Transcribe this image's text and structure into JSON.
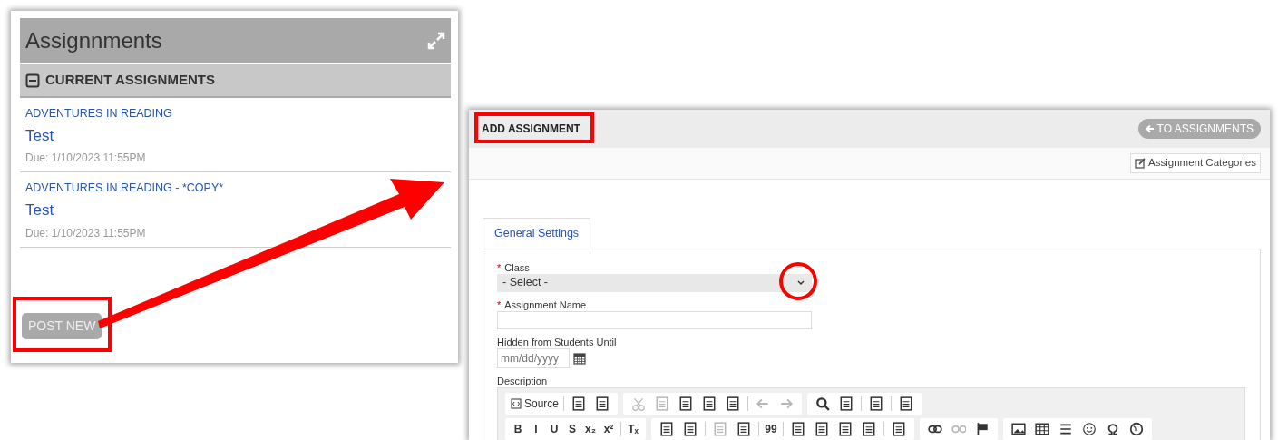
{
  "left_panel": {
    "title": "Assignnments",
    "section": {
      "title": "CURRENT ASSIGNMENTS",
      "expanded": true
    },
    "assignments": [
      {
        "class_name": "ADVENTURES IN READING",
        "title": "Test",
        "due": "Due: 1/10/2023 11:55PM"
      },
      {
        "class_name": "ADVENTURES IN READING - *COPY*",
        "title": "Test",
        "due": "Due: 1/10/2023 11:55PM"
      }
    ],
    "post_button": "POST NEW"
  },
  "right_panel": {
    "title": "ADD ASSIGNMENT",
    "back_button": "TO ASSIGNMENTS",
    "categories_button": "Assignment Categories",
    "tabs": [
      {
        "label": "General Settings",
        "selected": true
      }
    ],
    "fields": [
      {
        "kind": "select",
        "label": "Class",
        "required_mark": "*",
        "value": "- Select -"
      },
      {
        "kind": "text",
        "label": "Assignment Name",
        "required_mark": "*"
      },
      {
        "kind": "date",
        "label": "Hidden from Students Until",
        "placeholder": "mm/dd/yyyy"
      },
      {
        "kind": "editor",
        "label": "Description"
      }
    ],
    "toolbar_rows": [
      [
        [
          [
            {
              "kind": "icon-text",
              "label": "Source",
              "disabled": false
            }
          ],
          [
            {
              "kind": "icon",
              "disabled": false
            },
            {
              "kind": "icon",
              "disabled": false
            }
          ]
        ],
        [
          [
            {
              "kind": "icon",
              "disabled": true
            },
            {
              "kind": "icon",
              "disabled": true
            },
            {
              "kind": "icon",
              "disabled": false
            },
            {
              "kind": "icon",
              "disabled": false
            },
            {
              "kind": "icon",
              "disabled": false
            }
          ],
          [
            {
              "kind": "icon",
              "disabled": true
            },
            {
              "kind": "icon",
              "disabled": true
            }
          ]
        ],
        [
          [
            {
              "kind": "icon",
              "disabled": false
            },
            {
              "kind": "icon",
              "disabled": false
            }
          ],
          [
            {
              "kind": "icon",
              "disabled": false
            }
          ],
          [
            {
              "kind": "icon",
              "disabled": false
            }
          ]
        ]
      ],
      [
        [
          [
            {
              "kind": "glyph",
              "label": "B",
              "disabled": false
            },
            {
              "kind": "glyph",
              "label": "I",
              "disabled": false
            },
            {
              "kind": "glyph",
              "label": "U",
              "disabled": false
            },
            {
              "kind": "glyph",
              "label": "S",
              "disabled": false
            },
            {
              "kind": "glyph",
              "label": "x₂",
              "disabled": false
            },
            {
              "kind": "glyph",
              "label": "x²",
              "disabled": false
            }
          ],
          [
            {
              "kind": "glyph",
              "label": "Tₓ",
              "disabled": false
            }
          ]
        ],
        [
          [
            {
              "kind": "icon",
              "disabled": false
            },
            {
              "kind": "icon",
              "disabled": false
            }
          ],
          [
            {
              "kind": "icon",
              "disabled": true
            },
            {
              "kind": "icon",
              "disabled": false
            }
          ],
          [
            {
              "kind": "glyph",
              "label": "99",
              "disabled": false
            }
          ],
          [
            {
              "kind": "icon",
              "disabled": false
            },
            {
              "kind": "icon",
              "disabled": false
            },
            {
              "kind": "icon",
              "disabled": false
            },
            {
              "kind": "icon",
              "disabled": false
            }
          ],
          [
            {
              "kind": "icon",
              "disabled": false
            }
          ]
        ],
        [
          [
            {
              "kind": "icon",
              "disabled": false
            },
            {
              "kind": "icon",
              "disabled": true
            },
            {
              "kind": "icon",
              "disabled": false
            }
          ]
        ],
        [
          [
            {
              "kind": "icon",
              "disabled": false
            },
            {
              "kind": "icon",
              "disabled": false
            },
            {
              "kind": "icon",
              "disabled": false
            },
            {
              "kind": "icon",
              "disabled": false
            },
            {
              "kind": "icon",
              "disabled": false
            },
            {
              "kind": "icon",
              "disabled": false
            }
          ]
        ]
      ]
    ]
  }
}
